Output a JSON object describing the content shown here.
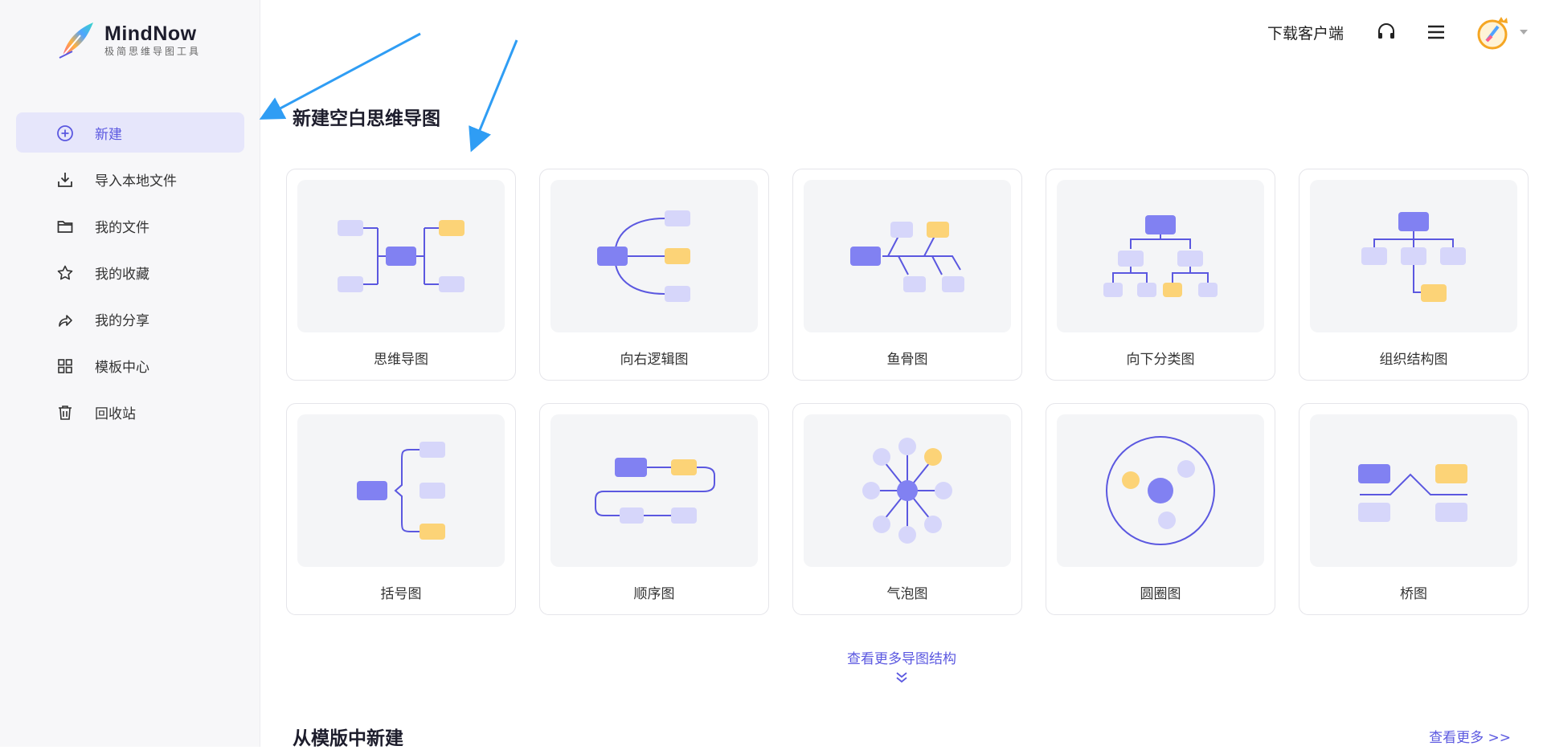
{
  "app": {
    "name": "MindNow",
    "tagline": "极简思维导图工具"
  },
  "sidebar": {
    "items": [
      {
        "label": "新建",
        "icon": "plus-circle-icon",
        "active": true
      },
      {
        "label": "导入本地文件",
        "icon": "import-icon",
        "active": false
      },
      {
        "label": "我的文件",
        "icon": "folder-icon",
        "active": false
      },
      {
        "label": "我的收藏",
        "icon": "star-icon",
        "active": false
      },
      {
        "label": "我的分享",
        "icon": "share-icon",
        "active": false
      },
      {
        "label": "模板中心",
        "icon": "grid-icon",
        "active": false
      },
      {
        "label": "回收站",
        "icon": "trash-icon",
        "active": false
      }
    ]
  },
  "topbar": {
    "download_label": "下载客户端"
  },
  "blank_section": {
    "title": "新建空白思维导图",
    "cards": [
      {
        "label": "思维导图",
        "icon": "mind-map-icon"
      },
      {
        "label": "向右逻辑图",
        "icon": "right-logic-icon"
      },
      {
        "label": "鱼骨图",
        "icon": "fishbone-icon"
      },
      {
        "label": "向下分类图",
        "icon": "down-tree-icon"
      },
      {
        "label": "组织结构图",
        "icon": "org-chart-icon"
      },
      {
        "label": "括号图",
        "icon": "bracket-icon"
      },
      {
        "label": "顺序图",
        "icon": "sequence-icon"
      },
      {
        "label": "气泡图",
        "icon": "bubble-icon"
      },
      {
        "label": "圆圈图",
        "icon": "circle-icon"
      },
      {
        "label": "桥图",
        "icon": "bridge-icon"
      }
    ],
    "more_label": "查看更多导图结构"
  },
  "template_section": {
    "title": "从模版中新建",
    "more_label": "查看更多 >>"
  },
  "colors": {
    "accent": "#5b58e0",
    "node_primary": "#8181f2",
    "node_light": "#d6d6fa",
    "node_yellow": "#fcd377"
  }
}
